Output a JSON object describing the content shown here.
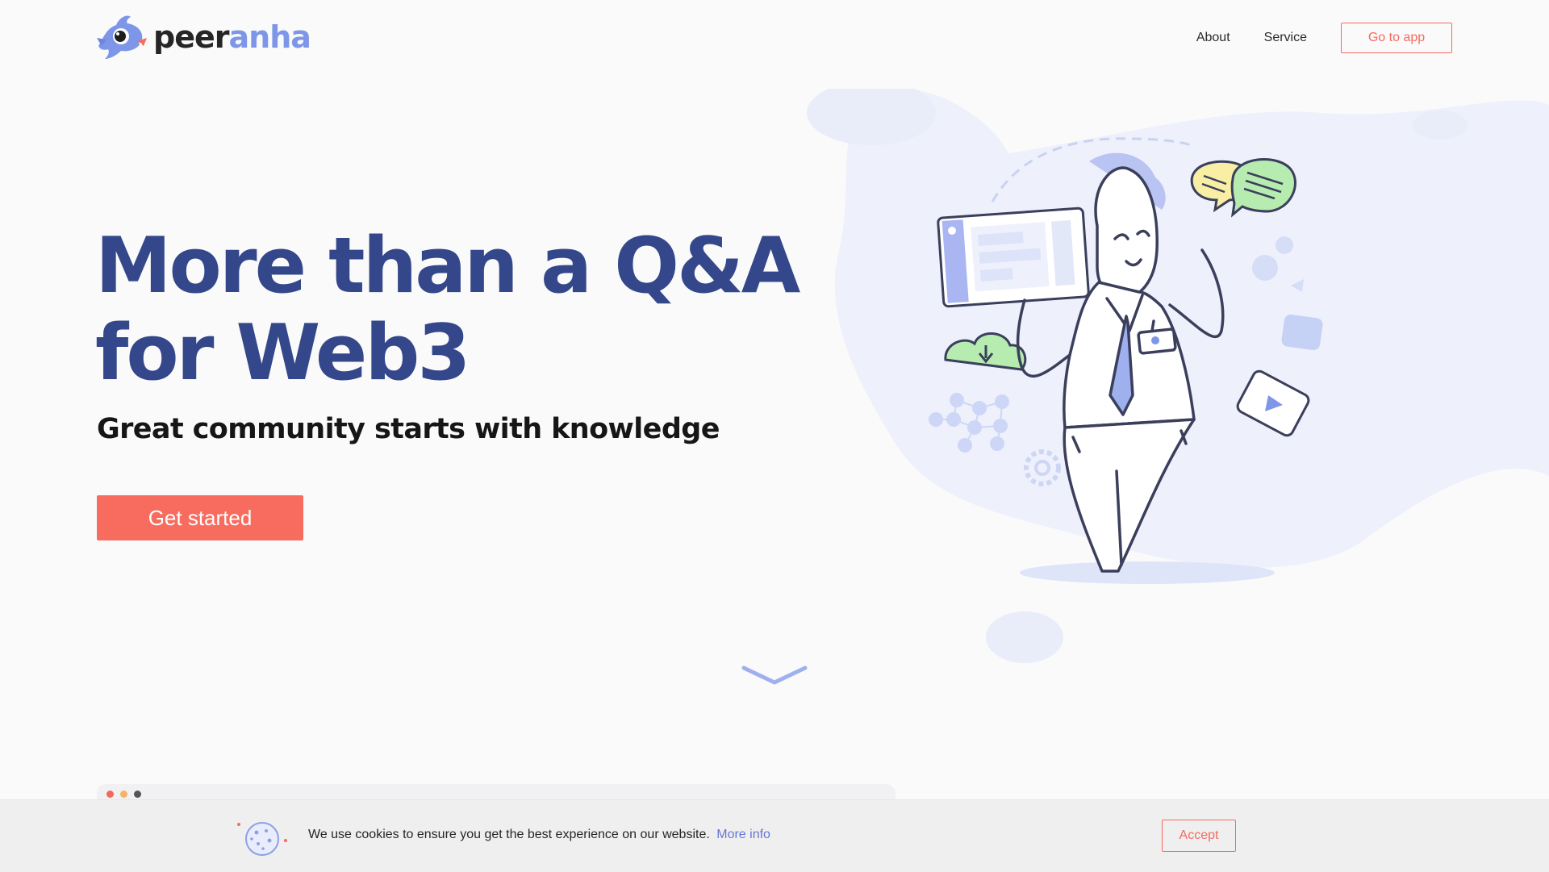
{
  "brand": {
    "name_part1": "peer",
    "name_part2": "anha"
  },
  "nav": {
    "items": [
      {
        "label": "About"
      },
      {
        "label": "Service"
      }
    ],
    "cta_label": "Go to app"
  },
  "hero": {
    "title_line1": "More than a Q&A",
    "title_line2": "for Web3",
    "subtitle": "Great community starts with knowledge",
    "cta_label": "Get started"
  },
  "cookie": {
    "text": "We use cookies to ensure you get the best experience on our website.",
    "link_label": "More info",
    "accept_label": "Accept"
  },
  "colors": {
    "heading": "#34478a",
    "accent": "#f76c5e",
    "brand_blue": "#7d96e8",
    "link": "#6577d6",
    "blob": "#eef1fb"
  },
  "icons": [
    "peeranha-logo-icon",
    "scroll-down-chevron-icon",
    "cookie-icon",
    "discord-icon",
    "slack-icon",
    "telegram-icon",
    "settings-gear-icon",
    "cloud-download-icon"
  ]
}
